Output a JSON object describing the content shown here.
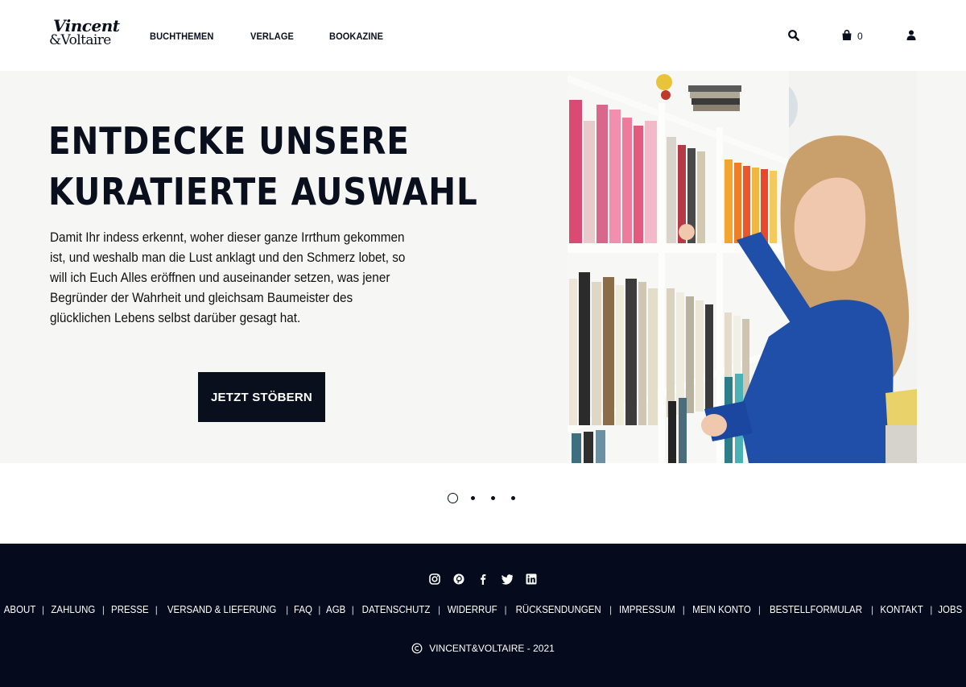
{
  "header": {
    "logo_line1": "Vincent",
    "logo_line2": "&Voltaire",
    "nav": [
      "BUCHTHEMEN",
      "VERLAGE",
      "BOOKAZINE"
    ],
    "cart_count": "0",
    "icons": [
      "search-icon",
      "shopping-bag-icon",
      "user-icon"
    ]
  },
  "hero": {
    "title_line1": "ENTDECKE UNSERE",
    "title_line2": "KURATIERTE AUSWAHL",
    "text": "Damit Ihr indess erkennt, woher dieser ganze Irrthum gekommen ist, und weshalb man die Lust anklagt und den Schmerz lobet, so will ich Euch Alles eröffnen und auseinander setzen, was jener Begründer der Wahrheit und gleichsam Baumeister des glücklichen Lebens selbst darüber gesagt hat.",
    "button_label": "JETZT STÖBERN"
  },
  "carousel": {
    "slides": 4,
    "active_index": 0
  },
  "footer": {
    "social": [
      "instagram-icon",
      "pinterest-icon",
      "facebook-icon",
      "twitter-icon",
      "linkedin-icon"
    ],
    "links": [
      "ABOUT",
      "ZAHLUNG",
      "PRESSE",
      "VERSAND & LIEFERUNG",
      "FAQ",
      "AGB",
      "DATENSCHUTZ",
      "WIDERRUF",
      "RÜCKSENDUNGEN",
      "IMPRESSUM",
      "MEIN KONTO",
      "BESTELLFORMULAR",
      "KONTAKT",
      "JOBS"
    ],
    "copyright": "VINCENT&VOLTAIRE - 2021"
  },
  "colors": {
    "navy": "#050b1d",
    "hero_bg": "#f6f6f4",
    "text": "#0a0f1e"
  }
}
